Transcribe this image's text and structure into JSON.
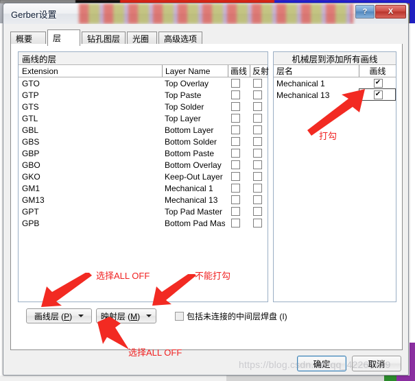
{
  "window": {
    "title": "Gerber设置",
    "help_label": "?",
    "close_label": "X"
  },
  "tabs": [
    {
      "label": "概要",
      "active": false
    },
    {
      "label": "层",
      "active": true
    },
    {
      "label": "钻孔图层",
      "active": false
    },
    {
      "label": "光圈",
      "active": false
    },
    {
      "label": "高级选项",
      "active": false
    }
  ],
  "plot_group": {
    "title": "画线的层",
    "columns": [
      "Extension",
      "Layer Name",
      "画线",
      "反射"
    ],
    "rows": [
      {
        "extension": "GTO",
        "layer_name": "Top Overlay",
        "plot": false,
        "mirror": false
      },
      {
        "extension": "GTP",
        "layer_name": "Top Paste",
        "plot": false,
        "mirror": false
      },
      {
        "extension": "GTS",
        "layer_name": "Top Solder",
        "plot": false,
        "mirror": false
      },
      {
        "extension": "GTL",
        "layer_name": "Top Layer",
        "plot": false,
        "mirror": false
      },
      {
        "extension": "GBL",
        "layer_name": "Bottom Layer",
        "plot": false,
        "mirror": false
      },
      {
        "extension": "GBS",
        "layer_name": "Bottom Solder",
        "plot": false,
        "mirror": false
      },
      {
        "extension": "GBP",
        "layer_name": "Bottom Paste",
        "plot": false,
        "mirror": false
      },
      {
        "extension": "GBO",
        "layer_name": "Bottom Overlay",
        "plot": false,
        "mirror": false
      },
      {
        "extension": "GKO",
        "layer_name": "Keep-Out Layer",
        "plot": false,
        "mirror": false
      },
      {
        "extension": "GM1",
        "layer_name": "Mechanical 1",
        "plot": false,
        "mirror": false
      },
      {
        "extension": "GM13",
        "layer_name": "Mechanical 13",
        "plot": false,
        "mirror": false
      },
      {
        "extension": "GPT",
        "layer_name": "Top Pad Master",
        "plot": false,
        "mirror": false
      },
      {
        "extension": "GPB",
        "layer_name": "Bottom Pad Maste",
        "plot": false,
        "mirror": false
      }
    ]
  },
  "mech_group": {
    "title": "机械层到添加所有画线",
    "columns": [
      "层名",
      "画线"
    ],
    "rows": [
      {
        "layer_name": "Mechanical 1",
        "plot": true,
        "selected": false
      },
      {
        "layer_name": "Mechanical 13",
        "plot": true,
        "selected": true
      }
    ]
  },
  "bottom": {
    "plot_layers_button": "画线层 (P)",
    "plot_layers_mnemonic": "P",
    "mirror_layers_button": "映射层 (M)",
    "mirror_layers_mnemonic": "M",
    "include_unconnected_label": "包括未连接的中间层焊盘 (I)",
    "include_unconnected_checked": false
  },
  "footer": {
    "ok_label": "确定",
    "cancel_label": "取消"
  },
  "annotations": [
    {
      "text": "打勾"
    },
    {
      "text": "选择ALL OFF"
    },
    {
      "text": "不能打勾"
    },
    {
      "text": "选择ALL OFF"
    }
  ],
  "watermark": {
    "text": "https://blog.csdn.net/qq_42265739"
  },
  "colors": {
    "annotation_red": "#f02020",
    "titlebar_text": "#0d1b33",
    "close_button": "#b8352c",
    "help_button": "#5488bd",
    "ok_focus_border": "#3c7fb1"
  }
}
